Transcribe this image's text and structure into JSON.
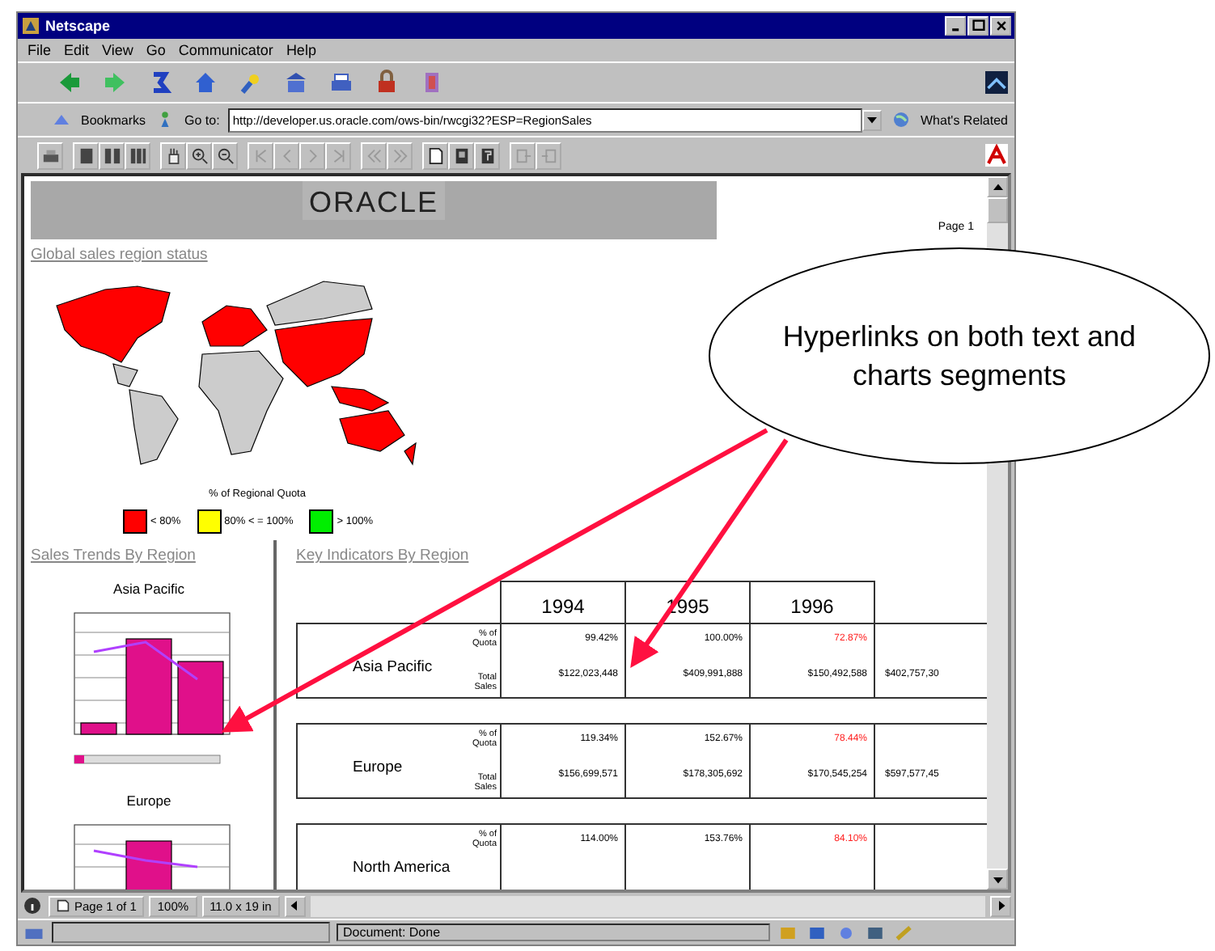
{
  "window": {
    "title": "Netscape"
  },
  "menu": [
    "File",
    "Edit",
    "View",
    "Go",
    "Communicator",
    "Help"
  ],
  "location": {
    "bookmarks": "Bookmarks",
    "goto_label": "Go to:",
    "url": "http://developer.us.oracle.com/ows-bin/rwcgi32?ESP=RegionSales",
    "related": "What's Related"
  },
  "report": {
    "banner": "ORACLE",
    "page": "Page 1",
    "map_link": "Global sales region status",
    "legend_title": "% of Regional Quota",
    "legend": [
      {
        "label": "< 80%",
        "color": "#ff0000"
      },
      {
        "label": "80% < = 100%",
        "color": "#ffff00"
      },
      {
        "label": "> 100%",
        "color": "#00ee00"
      }
    ],
    "trends": {
      "title": "Sales Trends By Region",
      "charts": [
        {
          "title": "Asia Pacific"
        },
        {
          "title": "Europe"
        }
      ]
    },
    "indicators": {
      "title": "Key Indicators By Region",
      "years": [
        "1994",
        "1995",
        "1996"
      ],
      "rows": [
        {
          "region": "Asia Pacific",
          "quota_label": "% of Quota",
          "sales_label": "Total Sales",
          "quota": [
            {
              "text": "99.42%",
              "alert": false
            },
            {
              "text": "100.00%",
              "alert": false
            },
            {
              "text": "72.87%",
              "alert": true
            }
          ],
          "sales": [
            "$122,023,448",
            "$409,991,888",
            "$150,492,588",
            "$402,757,30"
          ]
        },
        {
          "region": "Europe",
          "quota_label": "% of Quota",
          "sales_label": "Total Sales",
          "quota": [
            {
              "text": "119.34%",
              "alert": false
            },
            {
              "text": "152.67%",
              "alert": false
            },
            {
              "text": "78.44%",
              "alert": true
            }
          ],
          "sales": [
            "$156,699,571",
            "$178,305,692",
            "$170,545,254",
            "$597,577,45"
          ]
        },
        {
          "region": "North America",
          "quota_label": "% of Quota",
          "quota": [
            {
              "text": "114.00%",
              "alert": false
            },
            {
              "text": "153.76%",
              "alert": false
            },
            {
              "text": "84.10%",
              "alert": true
            }
          ]
        }
      ]
    }
  },
  "report_bar": {
    "page": "Page 1 of 1",
    "zoom": "100%",
    "size": "11.0 x 19 in"
  },
  "status_bar": {
    "text": "Document: Done"
  },
  "callout": {
    "text": "Hyperlinks on both text and charts segments"
  }
}
